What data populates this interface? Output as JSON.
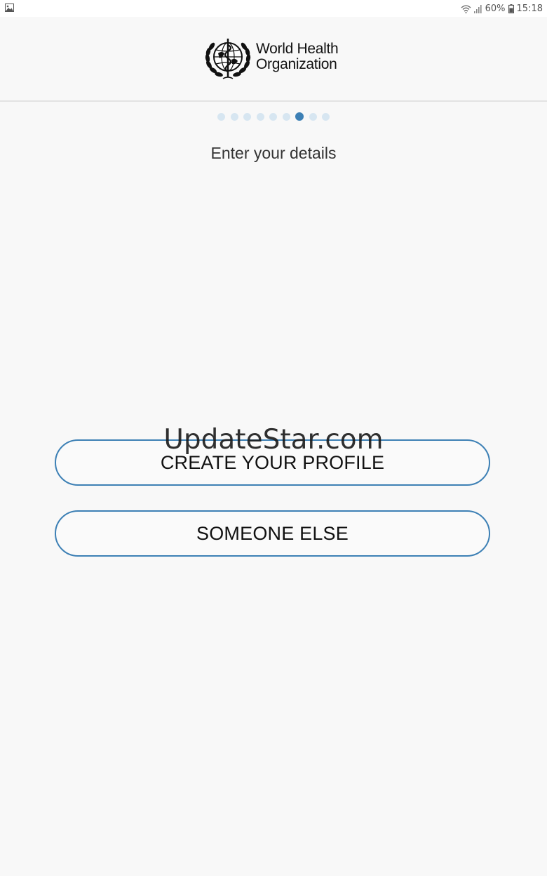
{
  "status_bar": {
    "battery": "60%",
    "time": "15:18"
  },
  "header": {
    "logo_line1": "World Health",
    "logo_line2": "Organization"
  },
  "pager": {
    "total_pages": 9,
    "current_page": 7
  },
  "main": {
    "subtitle": "Enter your details",
    "create_profile_label": "CREATE YOUR PROFILE",
    "someone_else_label": "SOMEONE ELSE"
  },
  "watermark": "UpdateStar.com",
  "colors": {
    "accent": "#3d80b5",
    "dot_inactive": "#d7e6f1",
    "background": "#f8f8f8"
  }
}
